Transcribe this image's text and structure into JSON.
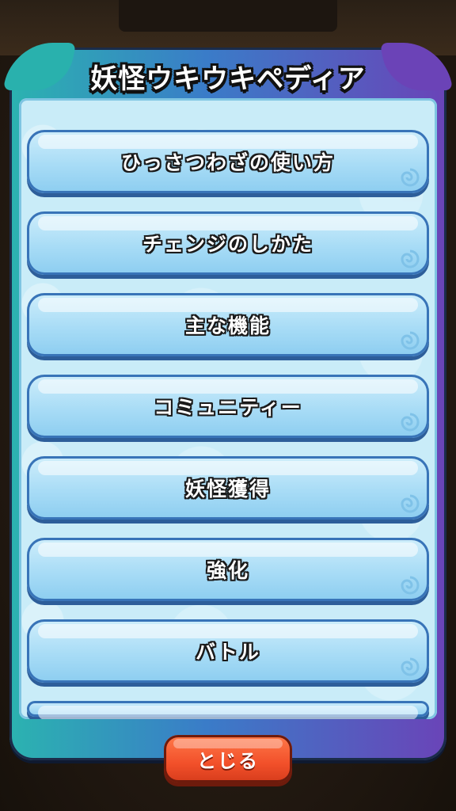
{
  "window": {
    "title": "妖怪ウキウキペディア"
  },
  "menu": {
    "items": [
      {
        "label": "ひっさつわざの使い方"
      },
      {
        "label": "チェンジのしかた"
      },
      {
        "label": "主な機能"
      },
      {
        "label": "コミュニティー"
      },
      {
        "label": "妖怪獲得"
      },
      {
        "label": "強化"
      },
      {
        "label": "バトル"
      }
    ]
  },
  "footer": {
    "close_label": "とじる"
  },
  "colors": {
    "frame_left": "#2bb3b0",
    "frame_right": "#6a44b8",
    "item_fill": "#a8dcf6",
    "item_border": "#3874b8",
    "close_button": "#f2502a"
  },
  "icons": {
    "item_icon": "swirl-icon"
  }
}
